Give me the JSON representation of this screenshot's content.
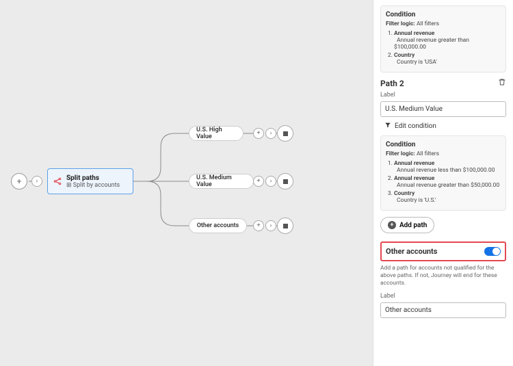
{
  "canvas": {
    "split_node": {
      "title": "Split paths",
      "subtitle": "Split by accounts",
      "subicon": "⊞"
    },
    "paths": {
      "p1": "U.S. High Value",
      "p2": "U.S. Medium Value",
      "p3": "Other accounts"
    }
  },
  "panel": {
    "cond1": {
      "hdr": "Condition",
      "filter_label": "Filter logic:",
      "filter_value": "All filters",
      "items": [
        {
          "lab": "Annual revenue",
          "det": "Annual revenue greater than $100,000.00"
        },
        {
          "lab": "Country",
          "det": "Country is 'USA'"
        }
      ]
    },
    "path2": {
      "title": "Path 2",
      "label_txt": "Label",
      "input_val": "U.S. Medium Value",
      "edit_txt": "Edit condition"
    },
    "cond2": {
      "hdr": "Condition",
      "filter_label": "Filter logic:",
      "filter_value": "All filters",
      "items": [
        {
          "lab": "Annual revenue",
          "det": "Annual revenue less than $100,000.00"
        },
        {
          "lab": "Annual revenue",
          "det": "Annual revenue greater than $50,000.00"
        },
        {
          "lab": "Country",
          "det": "Country is 'U.S.'"
        }
      ]
    },
    "add_path": "Add path",
    "other_accounts": {
      "title": "Other accounts",
      "desc": "Add a path for accounts not qualified for the above paths. If not, Journey will end for these accounts.",
      "label_txt": "Label",
      "input_val": "Other accounts"
    }
  }
}
